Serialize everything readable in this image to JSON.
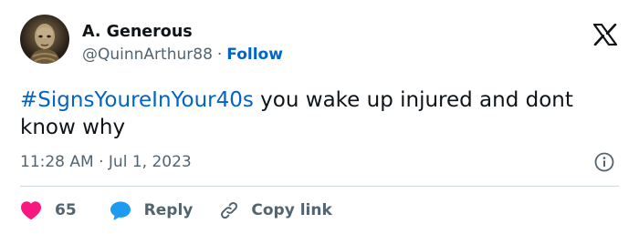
{
  "author": {
    "name": "A. Generous",
    "handle": "@QuinnArthur88",
    "separator": "·",
    "follow_label": "Follow"
  },
  "tweet": {
    "hashtag": "#SignsYoureInYour40s",
    "text": " you wake up injured and dont know why",
    "timestamp": "11:28 AM · Jul 1, 2023"
  },
  "actions": {
    "like_count": "65",
    "reply_label": "Reply",
    "copy_label": "Copy link"
  },
  "colors": {
    "link_blue": "#0064c8",
    "like_red": "#f91880",
    "reply_blue": "#1d9bf0",
    "muted_gray": "#536471",
    "divider": "#cfd9de"
  },
  "icons": {
    "brand": "x-logo-icon",
    "info": "info-icon",
    "like": "heart-icon",
    "reply": "speech-bubble-icon",
    "copy": "link-icon"
  }
}
